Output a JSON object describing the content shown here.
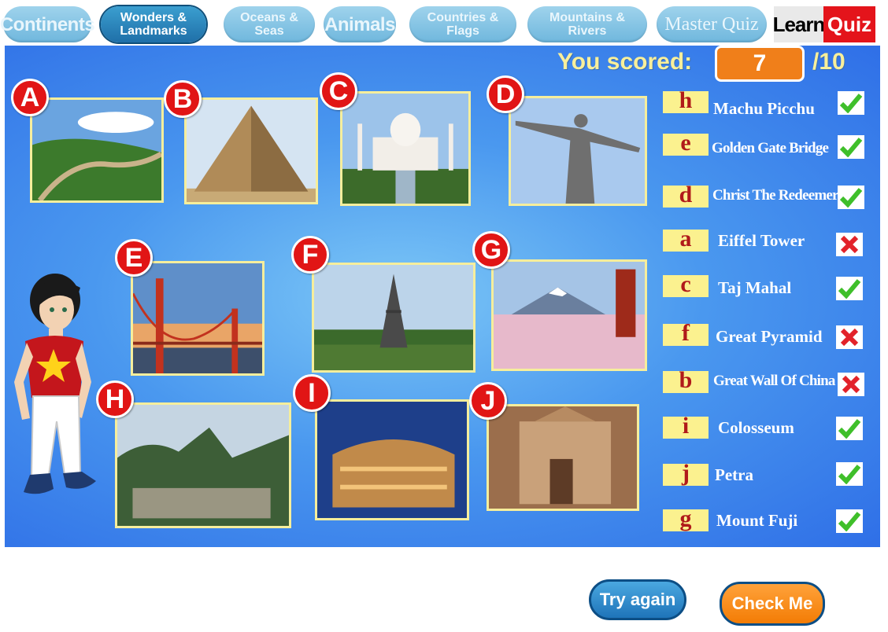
{
  "nav": {
    "tabs": [
      {
        "label": "Continents",
        "active": false
      },
      {
        "label": "Wonders & Landmarks",
        "active": true
      },
      {
        "label": "Oceans & Seas",
        "active": false
      },
      {
        "label": "Animals",
        "active": false
      },
      {
        "label": "Countries & Flags",
        "active": false
      },
      {
        "label": "Mountains & Rivers",
        "active": false
      },
      {
        "label": "Master Quiz",
        "active": false
      }
    ],
    "learn_label": "Learn",
    "quiz_label": "Quiz"
  },
  "score": {
    "label": "You scored:",
    "value": "7",
    "total": "/10"
  },
  "pictures": [
    {
      "letter": "A",
      "icon": "great-wall-photo"
    },
    {
      "letter": "B",
      "icon": "pyramid-photo"
    },
    {
      "letter": "C",
      "icon": "taj-mahal-photo"
    },
    {
      "letter": "D",
      "icon": "christ-redeemer-photo"
    },
    {
      "letter": "E",
      "icon": "golden-gate-photo"
    },
    {
      "letter": "F",
      "icon": "eiffel-tower-photo"
    },
    {
      "letter": "G",
      "icon": "mount-fuji-photo"
    },
    {
      "letter": "H",
      "icon": "machu-picchu-photo"
    },
    {
      "letter": "I",
      "icon": "colosseum-photo"
    },
    {
      "letter": "J",
      "icon": "petra-photo"
    }
  ],
  "answers": [
    {
      "answer": "h",
      "name": "Machu Picchu",
      "correct": true
    },
    {
      "answer": "e",
      "name": "Golden Gate Bridge",
      "correct": true
    },
    {
      "answer": "d",
      "name": "Christ The Redeemer",
      "correct": true
    },
    {
      "answer": "a",
      "name": "Eiffel Tower",
      "correct": false
    },
    {
      "answer": "c",
      "name": "Taj Mahal",
      "correct": true
    },
    {
      "answer": "f",
      "name": "Great Pyramid",
      "correct": false
    },
    {
      "answer": "b",
      "name": "Great Wall Of China",
      "correct": false
    },
    {
      "answer": "i",
      "name": "Colosseum",
      "correct": true
    },
    {
      "answer": "j",
      "name": "Petra",
      "correct": true
    },
    {
      "answer": "g",
      "name": "Mount Fuji",
      "correct": true
    }
  ],
  "buttons": {
    "try_again": "Try again",
    "check_me": "Check Me"
  },
  "colors": {
    "badge": "#e11515",
    "answer_box": "#fbf18f",
    "score_box": "#f07f1a",
    "correct": "#3fbf2a",
    "wrong": "#e2222a",
    "quiz_tab": "#e4141b"
  }
}
